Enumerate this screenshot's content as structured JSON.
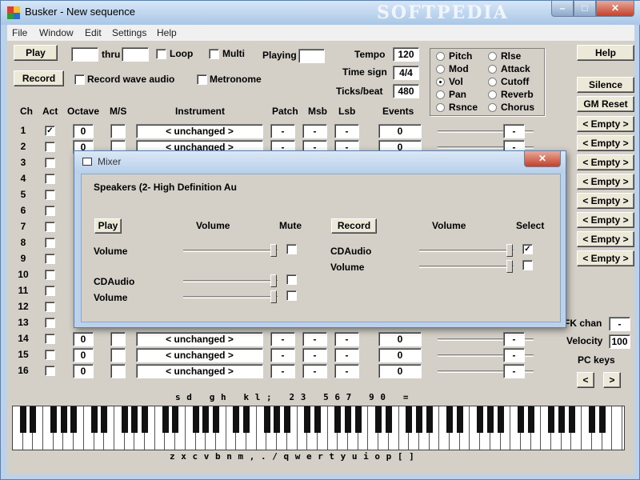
{
  "window": {
    "title": "Busker - New sequence",
    "watermark": "SOFTPEDIA",
    "controls": {
      "minimize": "–",
      "maximize": "□",
      "close": "✕"
    }
  },
  "menu": [
    "File",
    "Window",
    "Edit",
    "Settings",
    "Help"
  ],
  "transport": {
    "play_label": "Play",
    "record_label": "Record",
    "play_from_value": "",
    "thru_label": "thru",
    "play_to_value": "",
    "loop_label": "Loop",
    "multi_label": "Multi",
    "playing_label": "Playing",
    "playing_value": "",
    "record_wave_label": "Record wave audio",
    "metronome_label": "Metronome"
  },
  "timing": {
    "tempo_label": "Tempo",
    "tempo_value": "120",
    "timesig_label": "Time sign",
    "timesig_value": "4/4",
    "ticks_label": "Ticks/beat",
    "ticks_value": "480"
  },
  "controller_options": [
    {
      "label": "Pitch",
      "selected": false
    },
    {
      "label": "Rlse",
      "selected": false
    },
    {
      "label": "Mod",
      "selected": false
    },
    {
      "label": "Attack",
      "selected": false
    },
    {
      "label": "Vol",
      "selected": true
    },
    {
      "label": "Cutoff",
      "selected": false
    },
    {
      "label": "Pan",
      "selected": false
    },
    {
      "label": "Reverb",
      "selected": false
    },
    {
      "label": "Rsnce",
      "selected": false
    },
    {
      "label": "Chorus",
      "selected": false
    }
  ],
  "right_panel": {
    "help_label": "Help",
    "silence_label": "Silence",
    "gm_reset_label": "GM Reset",
    "presets": [
      "< Empty >",
      "< Empty >",
      "< Empty >",
      "< Empty >",
      "< Empty >",
      "< Empty >",
      "< Empty >",
      "< Empty >"
    ],
    "fk_chan_label": "FK chan",
    "fk_chan_value": "-",
    "velocity_label": "Velocity",
    "velocity_value": "100",
    "pc_keys_label": "PC keys",
    "pc_prev": "<",
    "pc_next": ">"
  },
  "columns": {
    "ch": "Ch",
    "act": "Act",
    "octave": "Octave",
    "ms": "M/S",
    "instrument": "Instrument",
    "patch": "Patch",
    "msb": "Msb",
    "lsb": "Lsb",
    "events": "Events"
  },
  "channels": [
    {
      "ch": "1",
      "act": true,
      "octave": "0",
      "instrument": "< unchanged >",
      "patch": "-",
      "msb": "-",
      "lsb": "-",
      "events": "0",
      "ctrl": "-"
    },
    {
      "ch": "2",
      "act": false,
      "octave": "0",
      "instrument": "< unchanged >",
      "patch": "-",
      "msb": "-",
      "lsb": "-",
      "events": "0",
      "ctrl": "-"
    },
    {
      "ch": "3",
      "act": false
    },
    {
      "ch": "4",
      "act": false
    },
    {
      "ch": "5",
      "act": false
    },
    {
      "ch": "6",
      "act": false
    },
    {
      "ch": "7",
      "act": false
    },
    {
      "ch": "8",
      "act": false
    },
    {
      "ch": "9",
      "act": false
    },
    {
      "ch": "10",
      "act": false
    },
    {
      "ch": "11",
      "act": false
    },
    {
      "ch": "12",
      "act": false
    },
    {
      "ch": "13",
      "act": false
    },
    {
      "ch": "14",
      "act": false,
      "octave": "0",
      "instrument": "< unchanged >",
      "patch": "-",
      "msb": "-",
      "lsb": "-",
      "events": "0",
      "ctrl": "-"
    },
    {
      "ch": "15",
      "act": false,
      "octave": "0",
      "instrument": "< unchanged >",
      "patch": "-",
      "msb": "-",
      "lsb": "-",
      "events": "0",
      "ctrl": "-"
    },
    {
      "ch": "16",
      "act": false,
      "octave": "0",
      "instrument": "< unchanged >",
      "patch": "-",
      "msb": "-",
      "lsb": "-",
      "events": "0",
      "ctrl": "-"
    }
  ],
  "keymap": {
    "upper": "s d   g h   k l ;   2 3   5 6 7   9 0   =",
    "lower": "z x c v b n m , . / q w e r t y u i o p [ ]"
  },
  "mixer": {
    "title": "Mixer",
    "device": "Speakers (2- High Definition Au",
    "play_label": "Play",
    "volume_header": "Volume",
    "mute_header": "Mute",
    "record_label": "Record",
    "record_volume_header": "Volume",
    "select_header": "Select",
    "play_rows": [
      {
        "label": "Volume",
        "muted": false
      },
      {
        "label": "CDAudio",
        "muted": false
      },
      {
        "label": "Volume",
        "muted": false
      }
    ],
    "record_rows": [
      {
        "label": "CDAudio",
        "selected": true
      },
      {
        "label": "Volume",
        "selected": false
      }
    ],
    "close": "✕"
  }
}
